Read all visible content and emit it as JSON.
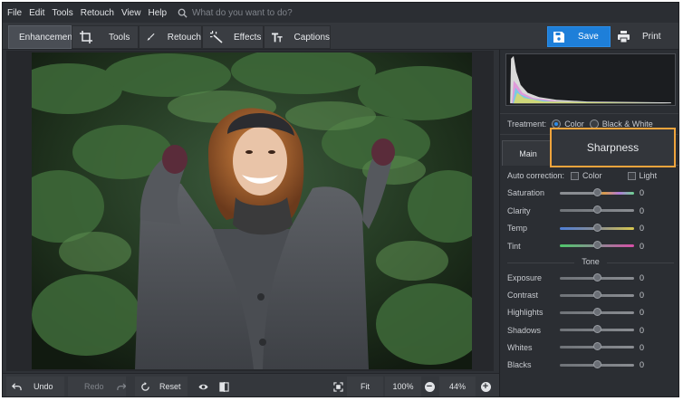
{
  "menu": {
    "items": [
      "File",
      "Edit",
      "Tools",
      "Retouch",
      "View",
      "Help"
    ],
    "search_placeholder": "What do you want to do?"
  },
  "toolbar": {
    "tabs": [
      {
        "label": "Enhancement",
        "icon": "sliders-icon",
        "active": true
      },
      {
        "label": "Tools",
        "icon": "crop-icon"
      },
      {
        "label": "Retouch",
        "icon": "brush-icon"
      },
      {
        "label": "Effects",
        "icon": "magic-wand-icon"
      },
      {
        "label": "Captions",
        "icon": "text-icon"
      }
    ],
    "save_label": "Save",
    "print_label": "Print",
    "accent": "#1e7fd9"
  },
  "panel": {
    "treatment": {
      "label": "Treatment:",
      "options": [
        "Color",
        "Black & White"
      ],
      "selected": "Color"
    },
    "tabs": {
      "main": "Main"
    },
    "callout": "Sharpness",
    "callout_color": "#f0a43c",
    "auto_correction": {
      "label": "Auto correction:",
      "options": [
        "Color",
        "Light"
      ]
    },
    "color_sliders": [
      {
        "label": "Saturation",
        "value": "0",
        "level": 0.5
      },
      {
        "label": "Clarity",
        "value": "0",
        "level": 0.5
      },
      {
        "label": "Temp",
        "value": "0",
        "level": 0.5
      },
      {
        "label": "Tint",
        "value": "0",
        "level": 0.5
      }
    ],
    "tone_header": "Tone",
    "tone_sliders": [
      {
        "label": "Exposure",
        "value": "0",
        "level": 0.5
      },
      {
        "label": "Contrast",
        "value": "0",
        "level": 0.5
      },
      {
        "label": "Highlights",
        "value": "0",
        "level": 0.5
      },
      {
        "label": "Shadows",
        "value": "0",
        "level": 0.5
      },
      {
        "label": "Whites",
        "value": "0",
        "level": 0.5
      },
      {
        "label": "Blacks",
        "value": "0",
        "level": 0.5
      }
    ]
  },
  "bottombar": {
    "undo_label": "Undo",
    "redo_label": "Redo",
    "reset_label": "Reset",
    "fit_label": "Fit",
    "zoom_100_label": "100%",
    "zoom_value": "44%"
  }
}
